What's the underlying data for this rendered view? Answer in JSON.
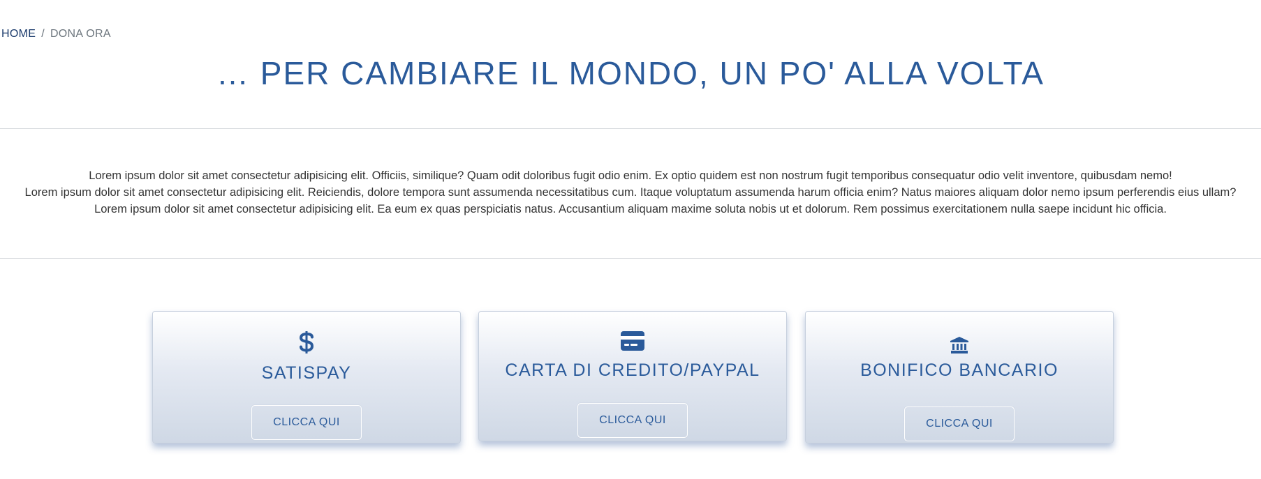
{
  "breadcrumb": {
    "home": "HOME",
    "separator": "/",
    "current": "DONA ORA"
  },
  "page": {
    "title": "… PER CAMBIARE IL MONDO, UN PO' ALLA VOLTA"
  },
  "intro": {
    "paragraphs": [
      "Lorem ipsum dolor sit amet consectetur adipisicing elit. Officiis, similique? Quam odit doloribus fugit odio enim. Ex optio quidem est non nostrum fugit temporibus consequatur odio velit inventore, quibusdam nemo!",
      "Lorem ipsum dolor sit amet consectetur adipisicing elit. Reiciendis, dolore tempora sunt assumenda necessitatibus cum. Itaque voluptatum assumenda harum officia enim? Natus maiores aliquam dolor nemo ipsum perferendis eius ullam?",
      "Lorem ipsum dolor sit amet consectetur adipisicing elit. Ea eum ex quas perspiciatis natus. Accusantium aliquam maxime soluta nobis ut et dolorum. Rem possimus exercitationem nulla saepe incidunt hic officia."
    ]
  },
  "cards": [
    {
      "icon": "dollar-icon",
      "title": "SATISPAY",
      "button": "CLICCA QUI"
    },
    {
      "icon": "credit-card-icon",
      "title": "CARTA DI CREDITO/PAYPAL",
      "button": "CLICCA QUI"
    },
    {
      "icon": "bank-icon",
      "title": "BONIFICO BANCARIO",
      "button": "CLICCA QUI"
    }
  ],
  "colors": {
    "accent": "#2a5a9a",
    "breadcrumb_home": "#1a3a6b",
    "text": "#333333",
    "rule": "#d5d8dc"
  }
}
